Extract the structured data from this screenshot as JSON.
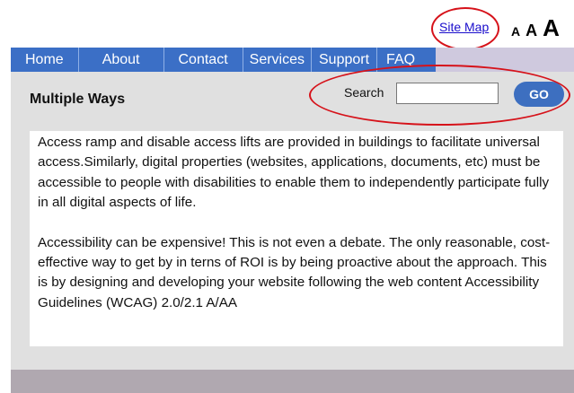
{
  "header": {
    "site_map_label": "Site Map",
    "font_sizes": [
      "A",
      "A",
      "A"
    ]
  },
  "nav": {
    "items": [
      "Home",
      "About",
      "Contact",
      "Services",
      "Support",
      "FAQ"
    ]
  },
  "main": {
    "title": "Multiple Ways",
    "search": {
      "label": "Search",
      "value": "",
      "button_label": "GO"
    },
    "paragraphs": [
      "Access ramp and disable access lifts are provided in buildings to facilitate universal access.Similarly, digital properties (websites, applications, documents, etc) must be accessible to people with disabilities to enable them to independently participate fully in all digital aspects of life.",
      "Accessibility can be expensive! This is not even a debate. The only reasonable, cost-effective way to get by in terns of ROI is by being proactive about the approach. This is by designing and developing your website following the web content Accessibility Guidelines (WCAG) 2.0/2.1 A/AA"
    ]
  },
  "colors": {
    "nav_background": "#3b6fc6",
    "highlight_ring": "#d6121a",
    "go_button": "#3d6fc0",
    "content_panel": "#e0e0e0"
  }
}
